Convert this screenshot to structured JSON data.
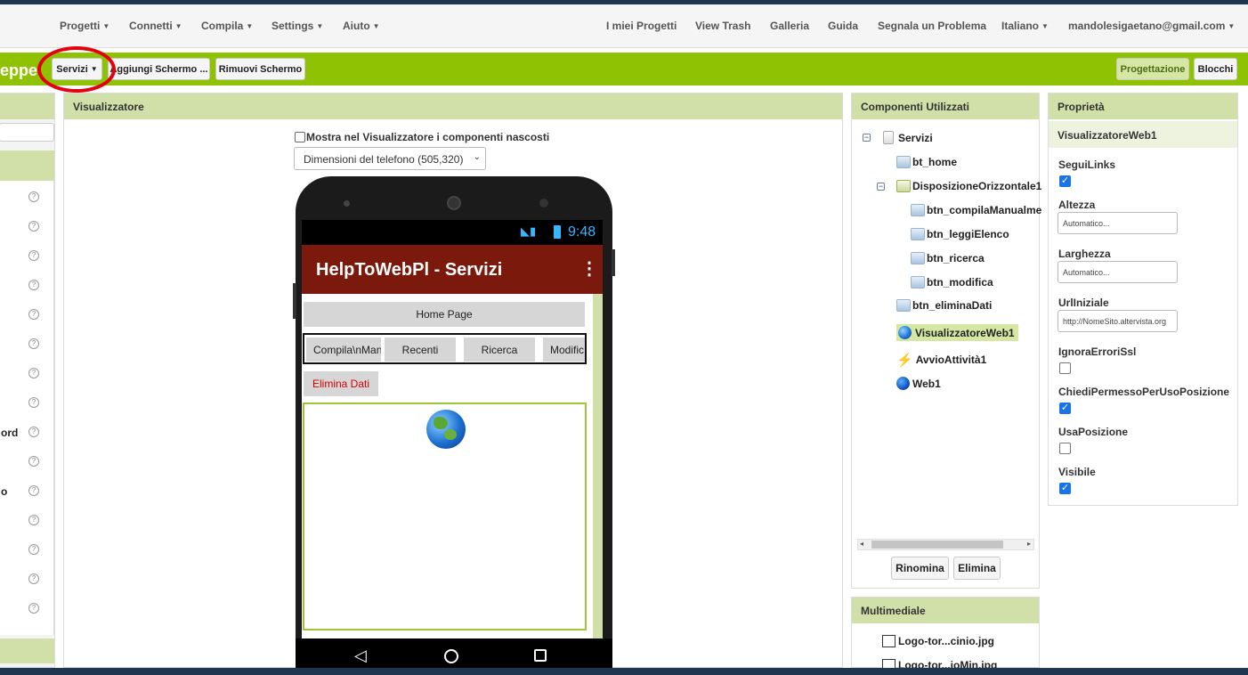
{
  "topnav": {
    "left_menus": [
      "Progetti",
      "Connetti",
      "Compila",
      "Settings",
      "Aiuto"
    ],
    "right_links": [
      "I miei Progetti",
      "View Trash",
      "Galleria",
      "Guida",
      "Segnala un Problema"
    ],
    "language": "Italiano",
    "account": "mandolesigaetano@gmail.com"
  },
  "toolbar": {
    "project_name": "eppe",
    "screen_select": "Servizi",
    "add_screen": "Aggiungi Schermo ...",
    "remove_screen": "Rimuovi Schermo",
    "designer": "Progettazione",
    "blocks": "Blocchi"
  },
  "palette": {
    "partial_labels": [
      "ord",
      "o"
    ],
    "help_glyph": "?"
  },
  "viewer": {
    "header": "Visualizzatore",
    "show_hidden_label": "Mostra nel Visualizzatore i componenti nascosti",
    "show_hidden_checked": false,
    "size_select": "Dimensioni del telefono (505,320)"
  },
  "phone": {
    "time": "9:48",
    "app_title": "HelpToWebPl - Servizi",
    "home_button": "Home Page",
    "row_buttons": [
      "Compila\\nManu",
      "Recenti",
      "Ricerca",
      "Modific"
    ],
    "delete_button": "Elimina Dati",
    "menu_icon": "overflow-menu-icon",
    "globe_icon": "globe-icon",
    "nav_icons": [
      "back-icon",
      "home-icon",
      "recents-icon"
    ]
  },
  "components": {
    "header": "Componenti Utilizzati",
    "tree": [
      {
        "label": "Servizi",
        "icon": "screen-icon",
        "depth": 0
      },
      {
        "label": "bt_home",
        "icon": "button-icon",
        "depth": 1
      },
      {
        "label": "DisposizioneOrizzontale1",
        "icon": "horizontal-arrangement-icon",
        "depth": 1
      },
      {
        "label": "btn_compilaManualme",
        "icon": "button-icon",
        "depth": 2
      },
      {
        "label": "btn_leggiElenco",
        "icon": "button-icon",
        "depth": 2
      },
      {
        "label": "btn_ricerca",
        "icon": "button-icon",
        "depth": 2
      },
      {
        "label": "btn_modifica",
        "icon": "button-icon",
        "depth": 2
      },
      {
        "label": "btn_eliminaDati",
        "icon": "button-icon",
        "depth": 1
      },
      {
        "label": "VisualizzatoreWeb1",
        "icon": "webviewer-icon",
        "depth": 1,
        "selected": true
      },
      {
        "label": "AvvioAttività1",
        "icon": "activity-starter-icon",
        "depth": 1
      },
      {
        "label": "Web1",
        "icon": "web-icon",
        "depth": 1
      }
    ],
    "rename": "Rinomina",
    "delete": "Elimina"
  },
  "media": {
    "header": "Multimediale",
    "items": [
      "Logo-tor...cinio.jpg",
      "Logo-tor...ioMin.jpg"
    ]
  },
  "properties": {
    "header": "Proprietà",
    "component": "VisualizzatoreWeb1",
    "follow_links": {
      "label": "SeguiLinks",
      "checked": true
    },
    "height": {
      "label": "Altezza",
      "value": "Automatico..."
    },
    "width": {
      "label": "Larghezza",
      "value": "Automatico..."
    },
    "home_url": {
      "label": "UrlIniziale",
      "value": "http://NomeSito.altervista.org"
    },
    "ignore_ssl": {
      "label": "IgnoraErroriSsl",
      "checked": false
    },
    "prompt_location": {
      "label": "ChiediPermessoPerUsoPosizione",
      "checked": true
    },
    "use_location": {
      "label": "UsaPosizione",
      "checked": false
    },
    "visible": {
      "label": "Visibile",
      "checked": true
    }
  },
  "colors": {
    "toolbar_green": "#8fc202",
    "panel_header": "#d1e0a8",
    "app_bar": "#7b1a0c",
    "annotation_red": "#e3000f"
  }
}
